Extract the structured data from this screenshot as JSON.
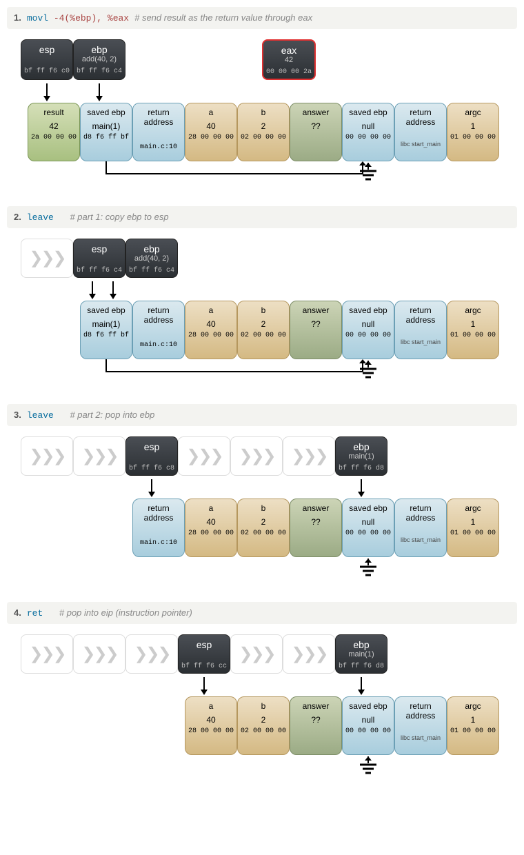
{
  "steps": [
    {
      "num": "1.",
      "instr1": "movl",
      "instr2": "-4(%ebp),",
      "instr3": "%eax",
      "comment": "# send result as the return value through eax",
      "showEax": true,
      "eaxVal": "42",
      "eaxHex": "00 00 00 2a",
      "ghostCount": 0,
      "espFunc": "",
      "espHex": "bf ff f6 c0",
      "ebpFunc": "add(40, 2)",
      "ebpHex": "bf ff f6 c4",
      "ebpPos": 5,
      "stackStart": 0
    },
    {
      "num": "2.",
      "instr1": "leave",
      "instr2": "",
      "instr3": "",
      "comment": "# part 1: copy ebp to esp",
      "showEax": false,
      "ghostCount": 1,
      "espFunc": "",
      "espHex": "bf ff f6 c4",
      "ebpFunc": "add(40, 2)",
      "ebpHex": "bf ff f6 c4",
      "ebpPos": 5,
      "stackStart": 1
    },
    {
      "num": "3.",
      "instr1": "leave",
      "instr2": "",
      "instr3": "",
      "comment": "# part 2: pop into ebp",
      "showEax": false,
      "ghostCount": 2,
      "espFunc": "",
      "espHex": "bf ff f6 c8",
      "ebpFunc": "main(1)",
      "ebpHex": "bf ff f6 d8",
      "ebpPos": 6,
      "ebpGhostPre": 3,
      "stackStart": 2
    },
    {
      "num": "4.",
      "instr1": "ret",
      "instr2": "",
      "instr3": "",
      "comment": "# pop into eip (instruction pointer)",
      "showEax": false,
      "ghostCount": 3,
      "espFunc": "",
      "espHex": "bf ff f6 cc",
      "ebpFunc": "main(1)",
      "ebpHex": "bf ff f6 d8",
      "ebpPos": 6,
      "ebpGhostPre": 2,
      "stackStart": 3
    }
  ],
  "cells": [
    {
      "label": "result",
      "val": "42",
      "sub": "",
      "hex": "2a 00 00 00",
      "color": "green"
    },
    {
      "label": "saved ebp",
      "val": "main(1)",
      "sub": "",
      "hex": "d8 f6 ff bf",
      "color": "blue"
    },
    {
      "label": "return address",
      "val": "",
      "sub": "",
      "hex": "main.c:10",
      "color": "blue"
    },
    {
      "label": "a",
      "val": "40",
      "sub": "",
      "hex": "28 00 00 00",
      "color": "tan"
    },
    {
      "label": "b",
      "val": "2",
      "sub": "",
      "hex": "02 00 00 00",
      "color": "tan"
    },
    {
      "label": "answer",
      "val": "??",
      "sub": "",
      "hex": "",
      "color": "olive"
    },
    {
      "label": "saved ebp",
      "val": "null",
      "sub": "",
      "hex": "00 00 00 00",
      "color": "blue"
    },
    {
      "label": "return address",
      "val": "",
      "sub": "libc start_main",
      "hex": "",
      "color": "blue"
    },
    {
      "label": "argc",
      "val": "1",
      "sub": "",
      "hex": "01 00 00 00",
      "color": "tan"
    }
  ],
  "regLabels": {
    "esp": "esp",
    "ebp": "ebp",
    "eax": "eax"
  },
  "groundCellIdx": 6
}
